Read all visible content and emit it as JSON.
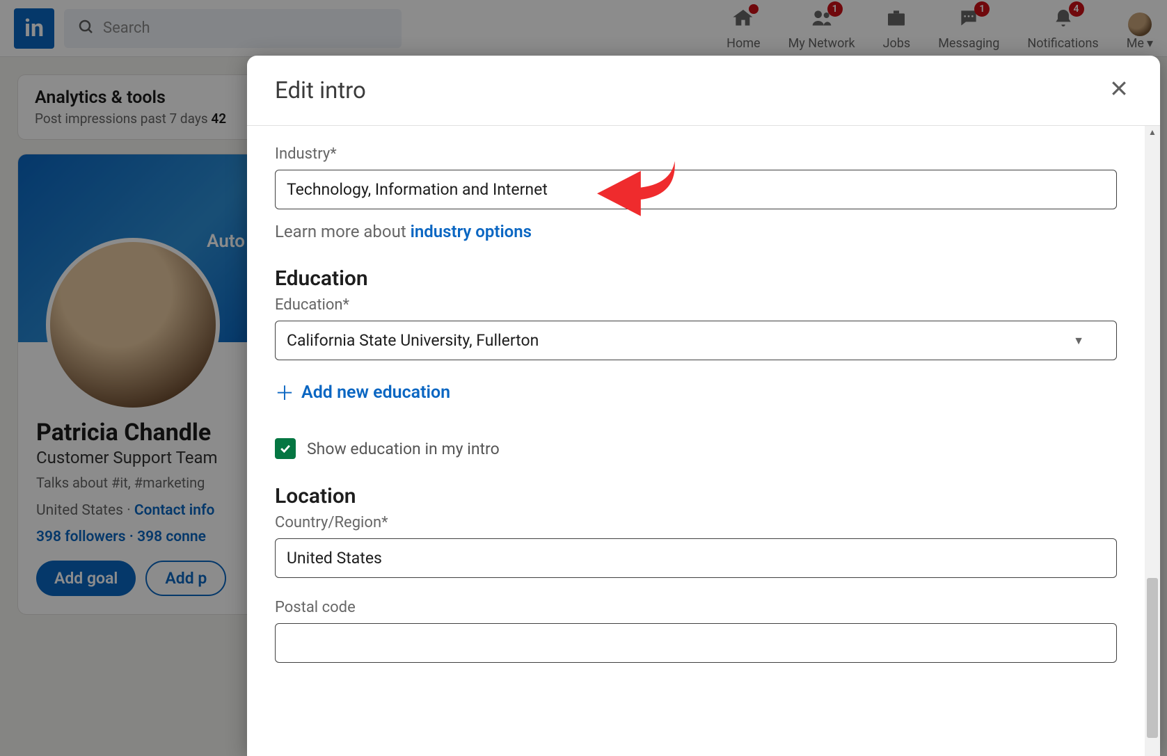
{
  "navbar": {
    "logo_text": "in",
    "search_placeholder": "Search",
    "items": [
      {
        "label": "Home",
        "badge": ""
      },
      {
        "label": "My Network",
        "badge": "1"
      },
      {
        "label": "Jobs",
        "badge": ""
      },
      {
        "label": "Messaging",
        "badge": "1"
      },
      {
        "label": "Notifications",
        "badge": "4"
      }
    ],
    "me_label": "Me"
  },
  "analytics": {
    "title": "Analytics & tools",
    "subtitle_prefix": "Post impressions past 7 days ",
    "subtitle_count": "42"
  },
  "profile": {
    "cover_text": "Auto",
    "name": "Patricia Chandle",
    "headline": "Customer Support Team",
    "talks": "Talks about #it, #marketing",
    "location": "United States",
    "separator": " · ",
    "contact_text": "Contact info",
    "followers": "398 followers",
    "connections": "398 conne",
    "stats_separator": "  ·  ",
    "btn_primary": "Add goal",
    "btn_secondary": "Add p"
  },
  "modal": {
    "title": "Edit intro",
    "industry": {
      "label": "Industry*",
      "value": "Technology, Information and Internet",
      "helper_prefix": "Learn more about ",
      "helper_link": "industry options"
    },
    "education": {
      "heading": "Education",
      "label": "Education*",
      "value": "California State University, Fullerton",
      "add_label": "Add new education",
      "show_checkbox_label": "Show education in my intro",
      "show_checked": true
    },
    "location": {
      "heading": "Location",
      "country_label": "Country/Region*",
      "country_value": "United States",
      "postal_label": "Postal code"
    }
  }
}
